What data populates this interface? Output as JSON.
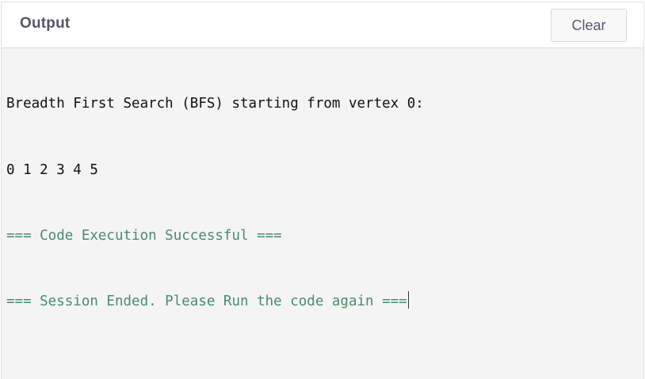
{
  "header": {
    "title": "Output",
    "clear_label": "Clear"
  },
  "console": {
    "lines": [
      {
        "text": "Breadth First Search (BFS) starting from vertex 0:",
        "kind": "stdout"
      },
      {
        "text": "0 1 2 3 4 5 ",
        "kind": "stdout"
      },
      {
        "text": "=== Code Execution Successful ===",
        "kind": "system"
      },
      {
        "text": "=== Session Ended. Please Run the code again ===",
        "kind": "system"
      }
    ]
  },
  "colors": {
    "stdout": "#111111",
    "system": "#4a8b6b",
    "console_bg": "#f4f4f4"
  }
}
